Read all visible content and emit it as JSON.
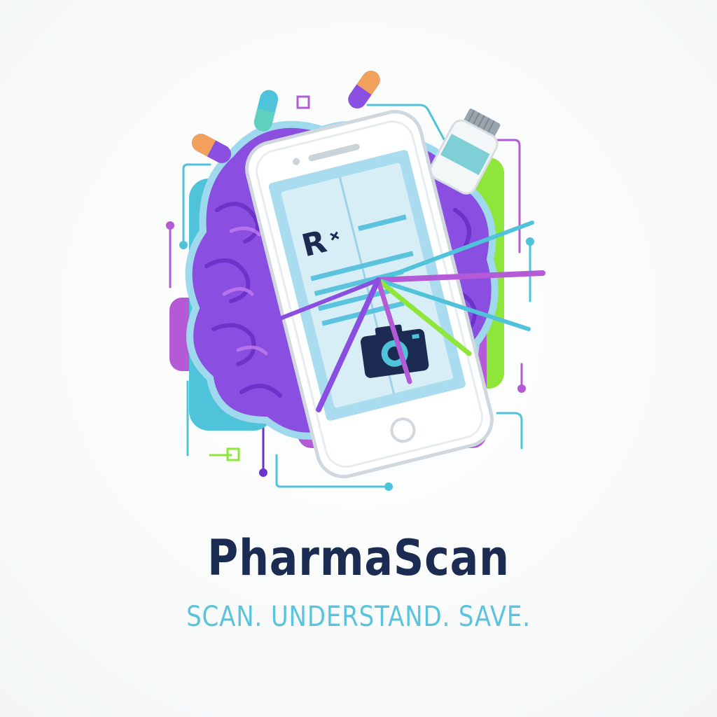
{
  "brand": {
    "name": "PharmaScan",
    "tagline": "SCAN. UNDERSTAND. SAVE.",
    "screen_symbol": "R"
  },
  "icons": [
    "brain-icon",
    "smartphone-icon",
    "prescription-icon",
    "camera-icon",
    "pill-capsule-icon",
    "medicine-bottle-icon",
    "circuit-lines-icon"
  ],
  "colors": {
    "brain": "#8a4fe0",
    "brain_dark": "#6b33c9",
    "teal": "#4fc3d9",
    "lime": "#8fe63a",
    "magenta": "#b55ad6",
    "navy": "#1b2b52",
    "tagline": "#5cc3de",
    "screen": "#a9dcee"
  }
}
